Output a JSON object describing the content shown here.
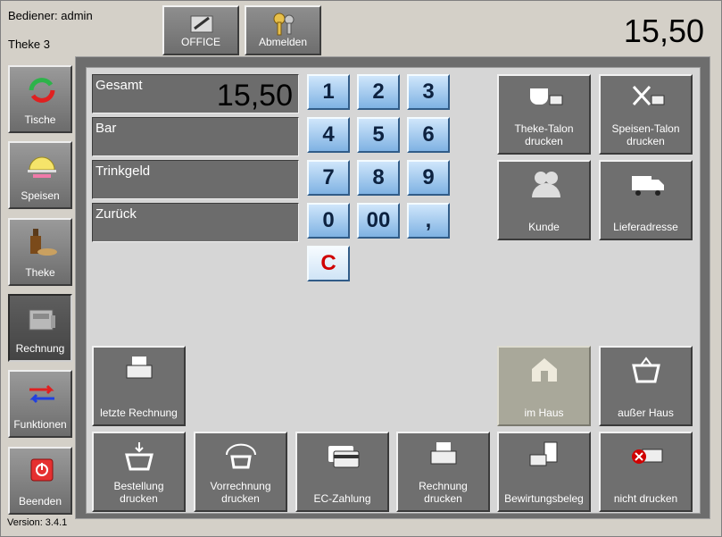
{
  "header": {
    "operator": "Bediener: admin",
    "station": "Theke 3",
    "total": "15,50",
    "office_label": "OFFICE",
    "logout_label": "Abmelden"
  },
  "sidebar": {
    "items": [
      {
        "label": "Tische"
      },
      {
        "label": "Speisen"
      },
      {
        "label": "Theke"
      },
      {
        "label": "Rechnung"
      },
      {
        "label": "Funktionen"
      },
      {
        "label": "Beenden"
      }
    ],
    "active": "Rechnung"
  },
  "version": "Version: 3.4.1",
  "payment": {
    "gesamt_label": "Gesamt",
    "gesamt_value": "15,50",
    "bar_label": "Bar",
    "trinkgeld_label": "Trinkgeld",
    "zurueck_label": "Zurück"
  },
  "keypad": {
    "k1": "1",
    "k2": "2",
    "k3": "3",
    "k4": "4",
    "k5": "5",
    "k6": "6",
    "k7": "7",
    "k8": "8",
    "k9": "9",
    "k0": "0",
    "k00": "00",
    "kcomma": ",",
    "kclear": "C"
  },
  "actions": {
    "theke_talon": "Theke-Talon drucken",
    "speisen_talon": "Speisen-Talon drucken",
    "kunde": "Kunde",
    "lieferadresse": "Lieferadresse",
    "letzte_rechnung": "letzte Rechnung",
    "im_haus": "im Haus",
    "ausser_haus": "außer Haus",
    "bestellung_drucken": "Bestellung drucken",
    "vorrechnung_drucken": "Vorrechnung drucken",
    "ec_zahlung": "EC-Zahlung",
    "rechnung_drucken": "Rechnung drucken",
    "bewirtungsbeleg": "Bewirtungsbeleg",
    "nicht_drucken": "nicht drucken"
  },
  "colors": {
    "keypad_blue": "#7fb2e3",
    "button_gray": "#6f6f6f",
    "disabled_khaki": "#a9a89a",
    "clear_red": "#d00000"
  }
}
